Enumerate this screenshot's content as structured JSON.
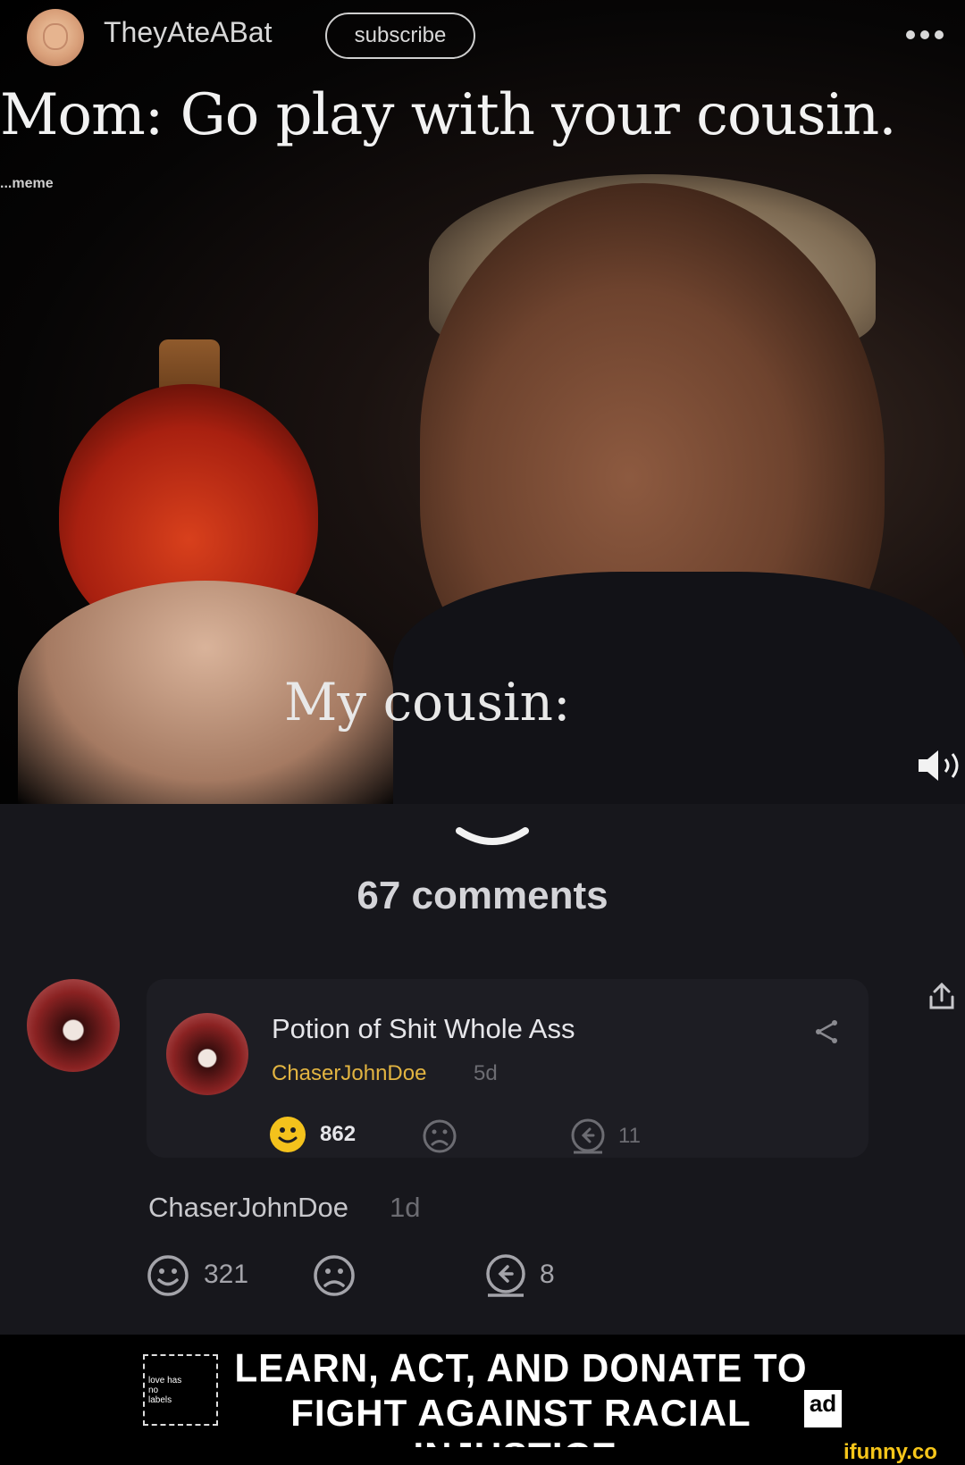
{
  "header": {
    "username": "TheyAteABat",
    "subscribe_label": "subscribe"
  },
  "media": {
    "caption_top": "Mom: Go play with your cousin.",
    "watermark": "...meme",
    "caption_bottom": "My cousin:"
  },
  "comments": {
    "count_label": "67 comments",
    "quoted": {
      "title": "Potion of Shit Whole Ass",
      "author": "ChaserJohnDoe",
      "time": "5d",
      "likes": "862",
      "replies": "11"
    },
    "comment": {
      "author": "ChaserJohnDoe",
      "time": "1d",
      "likes": "321",
      "replies": "8"
    }
  },
  "ad": {
    "logo_label": "love has no labels",
    "line1": "LEARN, ACT, AND DONATE TO",
    "line2": "FIGHT AGAINST RACIAL INJUSTICE.",
    "badge": "ad"
  },
  "footer": {
    "logo": "ifunny.co"
  },
  "colors": {
    "background": "#000000",
    "comments_bg": "#17171c",
    "card_bg": "#1d1d23",
    "author_gold": "#e2b441",
    "smile_yellow": "#f4c21c"
  }
}
